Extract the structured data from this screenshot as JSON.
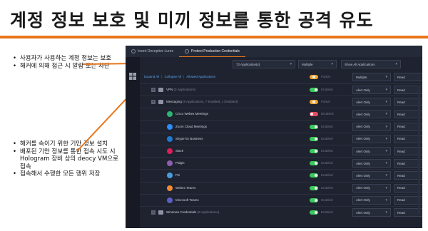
{
  "slide": {
    "title": "계정 정보 보호 및 미끼 정보를 통한 공격 유도",
    "bullets_top": [
      "사용자가 사용하는 계정 정보는 보호",
      "해커에 의해 접근 시 알람 또는 차단"
    ],
    "bullets_bottom": [
      "해커를 속이기 위한 기만 정보 설치",
      "배포된 기만 정보를 통한 접속 시도 시 Hologram 장비 상의 deocy VM으로 접속",
      "접속해서 수행한 모든 행위 저장"
    ],
    "accent": "#e8751a"
  },
  "app": {
    "tabs": [
      {
        "label": "Insert Deceptive Lures"
      },
      {
        "label": "Protect Production Credentials"
      }
    ],
    "filters": {
      "apps": "72 Application(s)",
      "mode": "Multiple",
      "view": "Show All Applications"
    },
    "actions": {
      "expand": "Expand All",
      "collapse": "Collapse All",
      "allowed": "Allowed Applications"
    },
    "top_row": {
      "status": "Partial",
      "mode": "Multiple",
      "access": "Read"
    },
    "rows": [
      {
        "kind": "group",
        "name": "VPN",
        "sub": "(3 Applications)",
        "toggle": "on",
        "status": "Enabled",
        "mode": "Alert Only",
        "access": "Read"
      },
      {
        "kind": "group",
        "name": "Messaging",
        "sub": "(8 Applications, 7 Enabled, 1 Disabled)",
        "toggle": "partial",
        "status": "Partial",
        "mode": "Alert Only",
        "access": "Read"
      },
      {
        "kind": "app",
        "name": "Cisco Webex Meetings",
        "icon_color": "#2bb673",
        "toggle": "off",
        "status": "Disabled",
        "mode": "Alert Only",
        "access": "Read"
      },
      {
        "kind": "app",
        "name": "Zoom Cloud Meetings",
        "icon_color": "#2d8cff",
        "toggle": "on",
        "status": "Enabled",
        "mode": "Alert Only",
        "access": "Read"
      },
      {
        "kind": "app",
        "name": "Skype for Business",
        "icon_color": "#1e7bd4",
        "toggle": "on",
        "status": "Enabled",
        "mode": "Alert Only",
        "access": "Read"
      },
      {
        "kind": "app",
        "name": "Slack",
        "icon_color": "#e01e5a",
        "toggle": "on",
        "status": "Enabled",
        "mode": "Alert Only",
        "access": "Read"
      },
      {
        "kind": "app",
        "name": "Pidgin",
        "icon_color": "#8e5fb0",
        "toggle": "on",
        "status": "Enabled",
        "mode": "Alert Only",
        "access": "Read"
      },
      {
        "kind": "app",
        "name": "Psi",
        "icon_color": "#4a9be0",
        "toggle": "on",
        "status": "Enabled",
        "mode": "Alert Only",
        "access": "Read"
      },
      {
        "kind": "app",
        "name": "Webex Teams",
        "icon_color": "#f28b30",
        "toggle": "on",
        "status": "Enabled",
        "mode": "Alert Only",
        "access": "Read"
      },
      {
        "kind": "app",
        "name": "Microsoft Teams",
        "icon_color": "#5b5fc7",
        "toggle": "on",
        "status": "Enabled",
        "mode": "Alert Only",
        "access": "Read"
      },
      {
        "kind": "group",
        "name": "Windows Credentials",
        "sub": "(8 Applications)",
        "toggle": "on",
        "status": "Enabled",
        "mode": "Alert Only",
        "access": "Read"
      }
    ]
  }
}
